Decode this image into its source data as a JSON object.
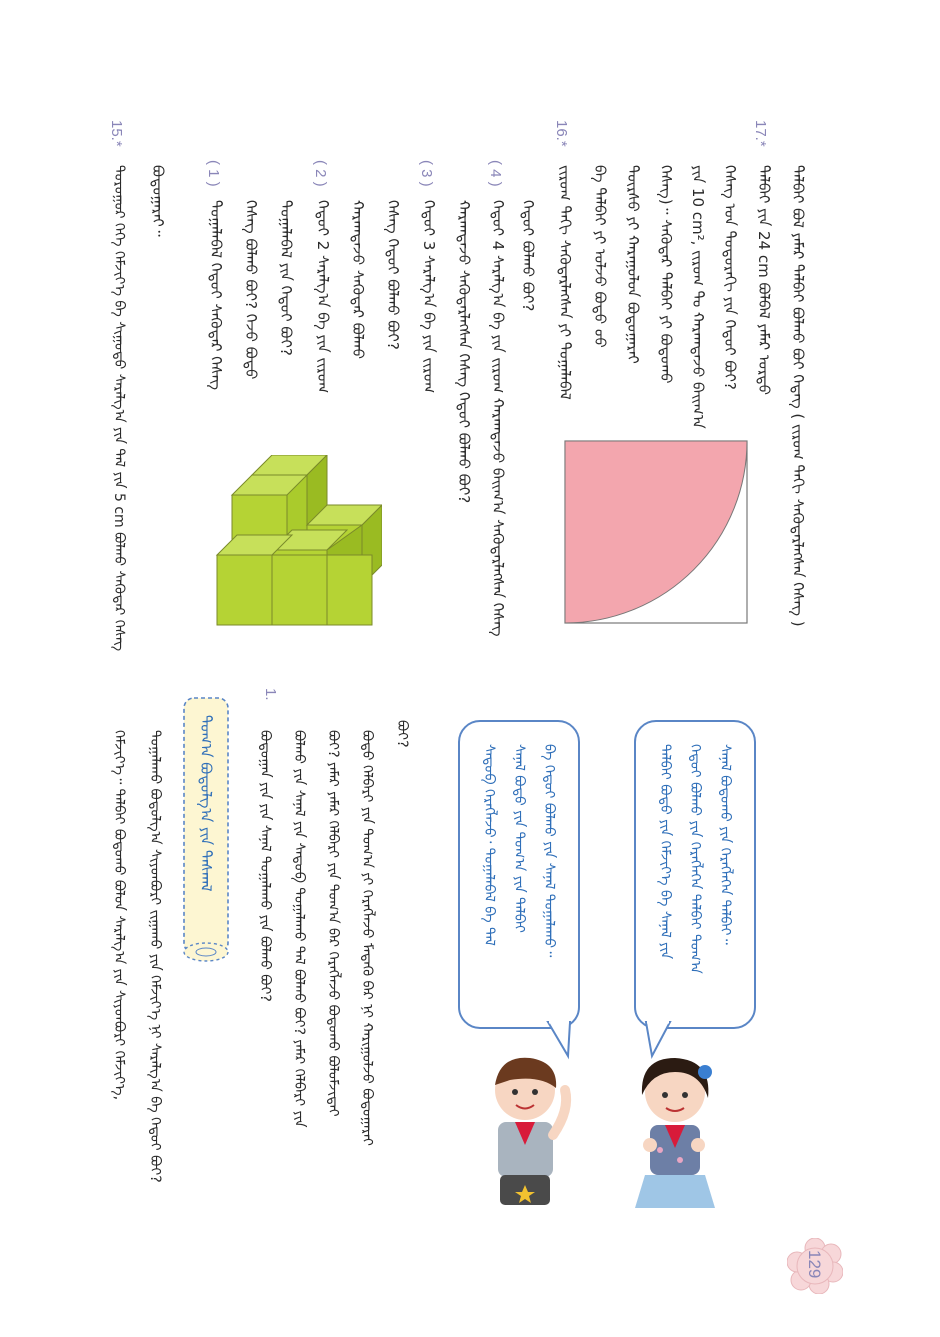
{
  "page": {
    "number": "129"
  },
  "problems": {
    "p17": {
      "num": "17.*",
      "line1": "ᠲᠠᠯᠪᠠᠢ ᠪᠣᠯ ᠶᠠᠮᠠᠷ ᠲᠠᠯᠪᠠᠢ ᠪᠣᠯᠬᠤ ᠪᠤᠢ ᠭᠡᠳᠡᠭ ( ᠵᠢᠷᠤᠭ ᠳᠡᠬᠢ ᠰᠡᠭᠦᠳᠡᠷᠯᠡᠭᠰᠡᠨ ᠬᠡᠰᠡᠭ )",
      "line2": "ᠲᠠᠯᠪᠠᠢ ᠶᠢᠨ 24 cm ᠪᠣᠯᠪᠠᠯ ᠶᠠᠮᠠᠷ ᠤᠷᠲᠤ",
      "line3": "ᠬᠡᠰᠡᠭ ᠤᠨ ᠳᠣᠲᠣᠷᠠᠬᠢ ᠶᠢᠨ ᠬᠡᠳᠦᠢ ᠪᠣᠢ?",
      "line4": "ᠶᠢᠨ 10 cm², ᠵᠢᠷᠤᠭ ᠲᠤ ᠬᠠᠷᠠᠭᠳᠠᠵᠤ ᠪᠠᠢᠭ᠎ᠠ",
      "line5": "ᠬᠡᠰᠡᠭ᠌)᠃ ᠰᠡᠭᠦᠳᠡᠷ ᠲᠠᠯᠪᠠᠢ ᠶᠢ ᠪᠣᠳᠣᠬᠤ",
      "line6": "ᠳᠦᠷᠰᠦ ᠶᠢ ᠬᠠᠷᠠᠭᠤᠯᠤᠨ ᠪᠣᠳᠣᠭᠠᠷᠠᠢ",
      "line7": "ᠪᠠ ᠲᠠᠯᠪᠠᠢ ᠶᠢ ᠣᠯᠵᠤ ᠪᠣᠳᠣ ᠤᠤ"
    },
    "p16": {
      "num": "16.*",
      "line1": "ᠵᠢᠷᠤᠭ ᠳᠡᠬᠢ ᠰᠡᠭᠦᠳᠡᠷᠯᠡᠭᠰᠡᠨ ᠶᠢ ᠲᠣᠭᠠᠯᠠᠪᠠᠯ",
      "line2": "ᠬᠡᠳᠦᠢ ᠪᠣᠯᠬᠤ ᠪᠤᠢ?"
    },
    "p15": {
      "num": "15.*",
      "intro": "ᠳᠣᠷᠤᠭᠤᠷ ᠬᠡᠬᠡ ᠬᠡᠮᠵᠢᠶ᠎ᠡ ᠪᠠ ᠰᠢᠭᠤᠳᠤ ᠰᠠᠷᠠᠯᠭ᠎ᠠ ᠶᠢᠨ ᠲᠠᠯ ᠶᠢᠨ 5 cm ᠪᠣᠯᠬᠤ ᠰᠡᠭᠦᠳᠡᠷ ᠬᠡᠰᠡᠭ",
      "q4_label": "( 4 )",
      "q4_l1": "ᠬᠡᠳᠦᠢ 4 ᠰᠠᠷᠠᠯᠭ᠎ᠠ ᠪᠠ ᠶᠢᠨ ᠵᠢᠷᠤᠭ ᠬᠠᠷᠠᠭᠳᠠᠵᠤ ᠪᠠᠢᠭ᠎ᠠ ᠰᠡᠭᠦᠳᠡᠷᠯᠡᠭᠰᠡᠨ ᠬᠡᠰᠡᠭ",
      "q4_l2": "ᠬᠠᠷᠠᠭᠳᠠᠵᠤ ᠰᠡᠭᠦᠳᠡᠷᠯᠡᠭᠰᠡᠨ ᠬᠡᠰᠡᠭ ᠬᠡᠳᠦᠢ ᠪᠣᠯᠬᠤ ᠪᠤᠢ?",
      "q3_label": "( 3 )",
      "q3_l1": "ᠬᠡᠳᠦᠢ 3 ᠰᠠᠷᠠᠯᠭ᠎ᠠ ᠪᠠ ᠶᠢᠨ ᠵᠢᠷᠤᠭ",
      "q3_l2": "ᠬᠡᠰᠡᠭ ᠬᠡᠳᠦᠢ ᠪᠣᠯᠬᠤ ᠪᠤᠢ?",
      "q3_l3": "ᠬᠠᠷᠠᠭᠳᠠᠵᠤ ᠰᠡᠭᠦᠳᠡᠷ ᠪᠣᠯᠬᠤ",
      "q2_label": "( 2 )",
      "q2_l1": "ᠬᠡᠳᠦᠢ 2 ᠰᠠᠷᠠᠯᠭ᠎ᠠ ᠪᠠ ᠶᠢᠨ ᠵᠢᠷᠤᠭ",
      "q2_l2": "ᠲᠣᠭᠠᠯᠠᠪᠠᠯ ᠶᠢᠨ ᠬᠡᠳᠦᠢ ᠪᠤᠢ?",
      "q2_l3": "ᠬᠡᠰᠡᠭ ᠪᠣᠯᠬᠤ ᠪᠤᠢ? ᠭᠡᠵᠦ ᠪᠣᠳᠣ",
      "q1_label": "( 1 )",
      "q1_l1": "ᠲᠣᠭᠠᠯᠠᠪᠠᠯ ᠬᠡᠳᠦᠢ ᠰᠡᠭᠦᠳᠡᠷ ᠬᠡᠰᠡᠭ",
      "q1_l2": "ᠪᠣᠳᠣᠭᠠᠷᠠᠢ᠃"
    },
    "exercise1": {
      "num": "1.",
      "line1": "ᠪᠣᠳᠣ ᠬᠡᠯᠪᠡᠷᠢ ᠶᠢᠨ ᠲᠣᠭ᠎ᠠ ᠶᠢ ᠬᠡᠷᠡᠭᠯᠡᠵᠦ ᠮᠡᠳᠡᠬᠦ ᠪᠠᠷ ᠨᠢ ᠬᠠᠷᠢᠭᠤᠯᠵᠤ ᠪᠣᠳᠣᠭᠠᠷᠠᠢ",
      "line2": "ᠪᠣᠢ? ᠶᠠᠮᠠᠷ ᠶᠠᠮᠠᠷ ᠬᠡᠯᠪᠡᠷᠢ ᠶᠢᠨ ᠲᠣᠭ᠎ᠠ ᠪᠠᠷ ᠬᠡᠷᠡᠭᠯᠡᠵᠦ ᠪᠣᠳᠣᠬᠤ ᠪᠣᠯᠤᠮᠵᠢᠲᠠᠢ",
      "line3": "ᠪᠣᠯᠬᠤ ᠶᠢᠨ ᠰᠠᠨᠠᠯ ᠶᠢᠨ ᠰᠡᠳᠦᠪ ᠲᠣᠭᠠᠯᠠᠬᠤ ᠲᠠᠯ ᠪᠣᠯᠬᠤ ᠪᠤᠢ? ᠶᠠᠮᠠᠷ ᠬᠡᠯᠪᠡᠷᠢ ᠶᠢᠨ",
      "line4": "ᠪᠣᠳᠣᠭᠠᠨ ᠶᠢᠨ ᠶᠢᠨ ᠰᠠᠨᠠᠯ ᠲᠣᠭᠠᠯᠠᠬᠤ ᠶᠢᠨ ᠪᠣᠯᠬᠤ ᠪᠤᠢ?",
      "line5": "ᠪᠣᠢ?"
    },
    "bottom": {
      "line1": "ᠲᠣᠭᠠᠯᠠᠬᠤ ᠪᠣᠳᠣᠯᠭ᠎ᠠ ᠰᠢᠶᠳᠪᠦᠷᠢ ᠵᠢᠭᠠᠬᠤ ᠶᠢᠨ ᠬᠡᠮᠵᠢᠶ᠎ᠡ ᠨᠢ ᠰᠠᠷᠠᠯᠭ᠎ᠠ ᠪᠠ ᠬᠡᠳᠦᠢ ᠪᠣᠢ?",
      "line2": "ᠬᠡᠮᠵᠢᠶ᠎ᠡ᠃ ᠲᠠᠯᠪᠠᠢ ᠪᠣᠳᠣᠬᠤ ᠪᠣᠯᠤᠨ ᠰᠠᠷᠠᠯᠭ᠎ᠠ ᠶᠢᠨ ᠰᠢᠶᠳᠪᠦᠷᠢ ᠬᠡᠮᠵᠢᠶ᠎ᠡ,"
    }
  },
  "bubbles": {
    "girl": {
      "line1": "ᠰᠠᠨᠠᠯ ᠪᠣᠳᠣᠬᠤ ᠶᠢᠨ ᠬᠡᠷᠡᠭᠯᠡᠭᠡᠨ ᠲᠠᠯᠪᠠᠢ᠃",
      "line2": "ᠬᠡᠳᠦᠢ ᠪᠣᠯᠬᠤ ᠶᠢᠨ ᠬᠡᠷᠡᠭᠯᠡᠭᠡᠨ ᠲᠠᠯᠪᠠᠢ ᠲᠣᠭ᠎ᠠ",
      "line3": "ᠲᠠᠯᠪᠠᠢ ᠪᠣᠳᠣ ᠶᠢᠨ ᠬᠡᠮᠵᠢᠶ᠎ᠡ ᠪᠠ ᠰᠠᠨᠠᠯ ᠶᠢᠨ"
    },
    "boy": {
      "line1": "ᠪᠠ ᠬᠡᠳᠦᠢ ᠪᠣᠯᠬᠤ ᠶᠢᠨ ᠰᠠᠨᠠᠯ ᠲᠣᠭᠠᠯᠠᠬᠤ᠃",
      "line2": "ᠰᠠᠨᠠᠯ ᠪᠣᠳᠣ ᠶᠢᠨ ᠲᠣᠭ᠎ᠠ ᠶᠢᠨ ᠲᠠᠯᠪᠠᠢ",
      "line3": "ᠰᠡᠳᠦᠪ ᠬᠡᠷᠡᠭᠯᠡᠵᠦ᠂ ᠲᠣᠭᠠᠯᠠᠪᠠᠯ ᠪᠠ ᠲᠠᠯ"
    }
  },
  "section_label": "ᠲᠣᠭ᠎ᠠ ᠪᠣᠳᠣᠯᠭ᠎ᠠ ᠶᠢᠨ ᠳᠠᠰᠬᠠᠯ",
  "colors": {
    "quarter_circle": "#f3a6ae",
    "cube_green": "#b5d334",
    "bubble_border": "#5a86c6",
    "bubble_text": "#2f6fb9",
    "number_color": "#8a86b8",
    "page_number_bg": "#f7d7d9"
  }
}
